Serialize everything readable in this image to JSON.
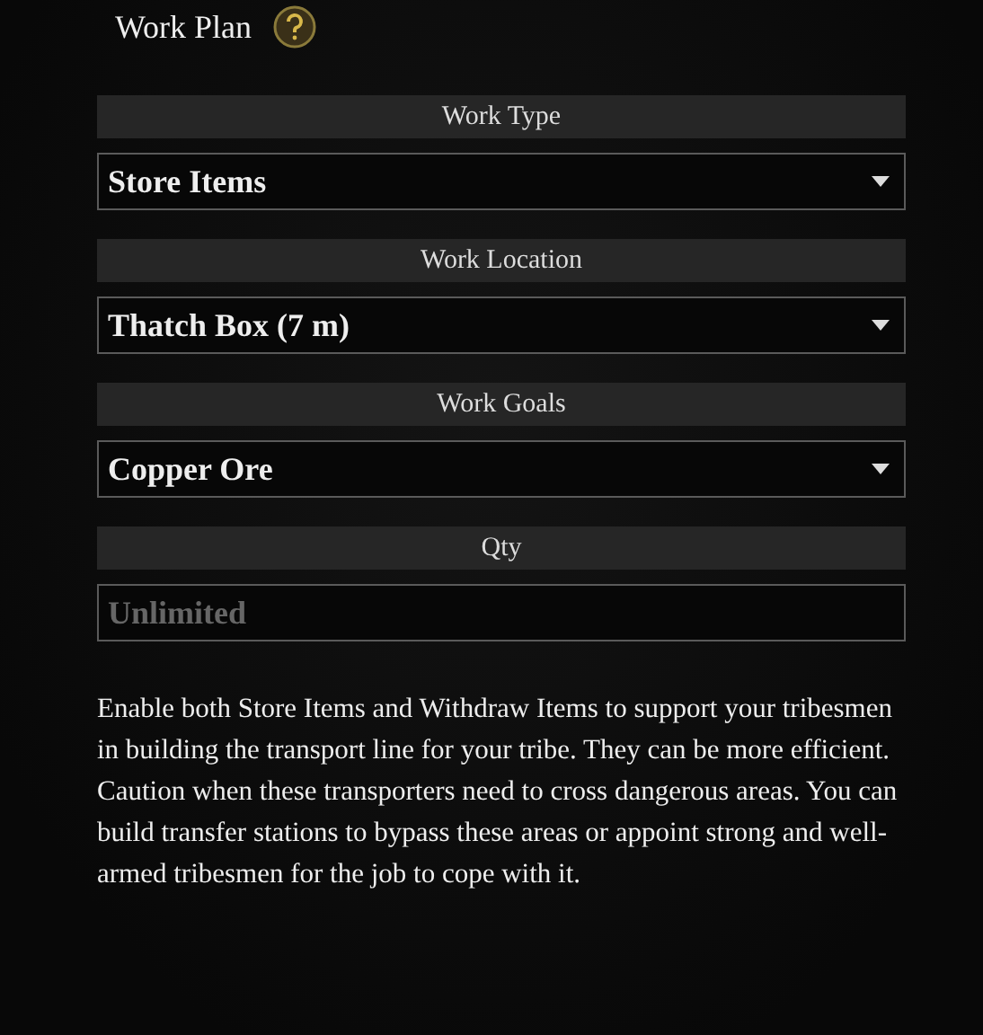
{
  "title": "Work Plan",
  "sections": [
    {
      "label": "Work Type",
      "kind": "dropdown",
      "value": "Store Items"
    },
    {
      "label": "Work Location",
      "kind": "dropdown",
      "value": "Thatch Box (7 m)"
    },
    {
      "label": "Work Goals",
      "kind": "dropdown",
      "value": "Copper Ore"
    },
    {
      "label": "Qty",
      "kind": "input",
      "placeholder": "Unlimited"
    }
  ],
  "description": "Enable both Store Items and Withdraw Items to support your tribesmen in building the transport line for your tribe. They can be more efficient. Caution when these transporters need to cross dangerous areas. You can build transfer stations to bypass these areas or appoint strong and well-armed tribesmen for the job to cope with it."
}
